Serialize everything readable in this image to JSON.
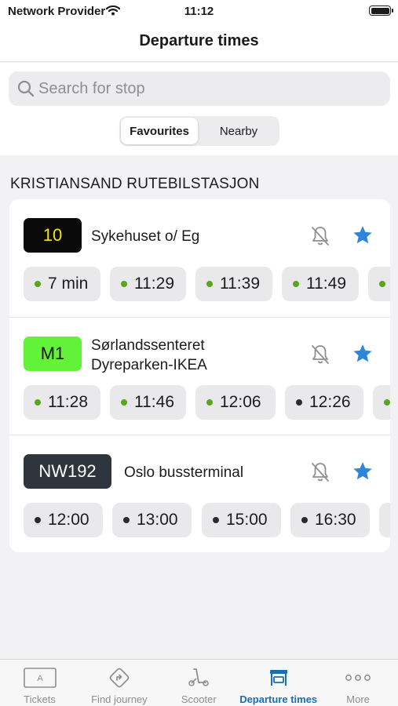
{
  "status": {
    "carrier": "Network Provider",
    "time": "11:12"
  },
  "header": {
    "title": "Departure times"
  },
  "search": {
    "placeholder": "Search for stop"
  },
  "segments": {
    "favourites": "Favourites",
    "nearby": "Nearby"
  },
  "section": {
    "title": "KRISTIANSAND RUTEBILSTASJON"
  },
  "colors": {
    "accent": "#1a6fb3",
    "star": "#2f86d9",
    "realtime_dot": "#5aa51c",
    "scheduled_dot": "#2b2b2b"
  },
  "routes": [
    {
      "line": "10",
      "line_bg": "#0a0a0a",
      "line_fg": "#f5e200",
      "destination": [
        "Sykehuset o/ Eg"
      ],
      "departures": [
        {
          "time": "7 min",
          "realtime": true
        },
        {
          "time": "11:29",
          "realtime": true
        },
        {
          "time": "11:39",
          "realtime": true
        },
        {
          "time": "11:49",
          "realtime": true
        },
        {
          "time": "",
          "realtime": true
        }
      ]
    },
    {
      "line": "M1",
      "line_bg": "#63f23a",
      "line_fg": "#111111",
      "destination": [
        "Sørlandssenteret",
        "Dyreparken-IKEA"
      ],
      "departures": [
        {
          "time": "11:28",
          "realtime": true
        },
        {
          "time": "11:46",
          "realtime": true
        },
        {
          "time": "12:06",
          "realtime": true
        },
        {
          "time": "12:26",
          "realtime": false
        },
        {
          "time": "",
          "realtime": true
        }
      ]
    },
    {
      "line": "NW192",
      "line_bg": "#2f353d",
      "line_fg": "#ffffff",
      "destination": [
        "Oslo bussterminal"
      ],
      "departures": [
        {
          "time": "12:00",
          "realtime": false
        },
        {
          "time": "13:00",
          "realtime": false
        },
        {
          "time": "15:00",
          "realtime": false
        },
        {
          "time": "16:30",
          "realtime": false
        },
        {
          "time": "",
          "realtime": false
        }
      ]
    }
  ],
  "tabs": [
    {
      "label": "Tickets",
      "icon": "ticket-icon",
      "active": false
    },
    {
      "label": "Find journey",
      "icon": "route-icon",
      "active": false
    },
    {
      "label": "Scooter",
      "icon": "scooter-icon",
      "active": false
    },
    {
      "label": "Departure times",
      "icon": "bus-stop-icon",
      "active": true
    },
    {
      "label": "More",
      "icon": "more-icon",
      "active": false
    }
  ]
}
